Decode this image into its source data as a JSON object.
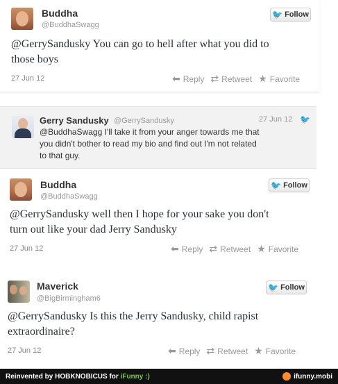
{
  "tweets": [
    {
      "name": "Buddha",
      "handle": "@BuddhaSwagg",
      "follow": "Follow",
      "text_line1": "@GerrySandusky You can go to hell after what you did to",
      "text_line2": "those boys",
      "date": "27 Jun 12",
      "reply": "Reply",
      "retweet": "Retweet",
      "favorite": "Favorite"
    },
    {
      "name": "Buddha",
      "handle": "@BuddhaSwagg",
      "follow": "Follow",
      "text_line1": "@GerrySandusky well then I hope for your sake you don't",
      "text_line2": "turn out like your dad Jerry Sandusky",
      "date": "27 Jun 12",
      "reply": "Reply",
      "retweet": "Retweet",
      "favorite": "Favorite"
    },
    {
      "name": "Maverick",
      "handle": "@BigBirmingham6",
      "follow": "Follow",
      "text_line1": "@GerrySandusky Is this the Jerry Sandusky, child rapist",
      "text_line2": "extraordinaire?",
      "date": "27 Jun 12",
      "reply": "Reply",
      "retweet": "Retweet",
      "favorite": "Favorite"
    }
  ],
  "reply_tweet": {
    "name": "Gerry Sandusky",
    "handle": "@GerrySandusky",
    "date": "27 Jun 12",
    "line1": "@BuddhaSwagg I'll take it from your anger towards me that",
    "line2": "you didn't bother to read my bio and find out I'm not related",
    "line3": "to that guy."
  },
  "footer": {
    "left_prefix": "Reinvented by HOBKNOBICUS for ",
    "brand": "iFunny :)",
    "right": "ifunny.mobi"
  },
  "colors": {
    "twitter_blue": "#2ea3e3",
    "footer_bg": "#111111",
    "ifunny_orange": "#ff8c26"
  }
}
